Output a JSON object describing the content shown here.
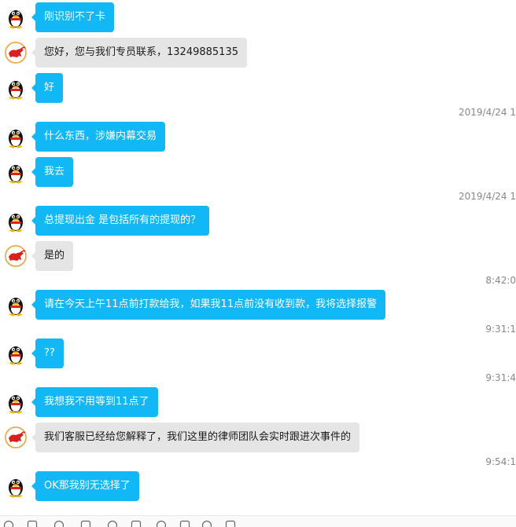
{
  "colors": {
    "bubble_self": "#12b7f5",
    "bubble_other": "#e5e5e5",
    "timestamp": "#888888"
  },
  "messages": [
    {
      "sender": "self",
      "avatar": "penguin-avatar",
      "text": "刚识别不了卡"
    },
    {
      "sender": "other",
      "avatar": "bull-avatar",
      "text": "您好，您与我们专员联系，13249885135"
    },
    {
      "sender": "self",
      "avatar": "penguin-avatar",
      "text": "好"
    },
    {
      "sender": "time",
      "text": "2019/4/24 1"
    },
    {
      "sender": "self",
      "avatar": "penguin-avatar",
      "text": "什么东西，涉嫌内幕交易"
    },
    {
      "sender": "self",
      "avatar": "penguin-avatar",
      "text": "我去"
    },
    {
      "sender": "time",
      "text": "2019/4/24 1"
    },
    {
      "sender": "self",
      "avatar": "penguin-avatar",
      "text": "总提现出金 是包括所有的提现的？"
    },
    {
      "sender": "other",
      "avatar": "bull-avatar",
      "text": "是的"
    },
    {
      "sender": "time",
      "text": "8:42:0"
    },
    {
      "sender": "self",
      "avatar": "penguin-avatar",
      "text": "请在今天上午11点前打款给我，如果我11点前没有收到款，我将选择报警"
    },
    {
      "sender": "time",
      "text": "9:31:1"
    },
    {
      "sender": "self",
      "avatar": "penguin-avatar",
      "text": "??"
    },
    {
      "sender": "time",
      "text": "9:31:4"
    },
    {
      "sender": "self",
      "avatar": "penguin-avatar",
      "text": "我想我不用等到11点了"
    },
    {
      "sender": "other",
      "avatar": "bull-avatar",
      "text": "我们客服已经给您解释了，我们这里的律师团队会实时跟进次事件的"
    },
    {
      "sender": "time",
      "text": "9:54:1"
    },
    {
      "sender": "self",
      "avatar": "penguin-avatar",
      "text": "OK那我别无选择了"
    }
  ],
  "toolbar": [
    "emoji-icon",
    "screenshot-icon",
    "scissors-icon",
    "folder-icon",
    "image-icon",
    "chat-icon",
    "shake-icon",
    "phone-icon",
    "gear-icon",
    "history-icon"
  ]
}
